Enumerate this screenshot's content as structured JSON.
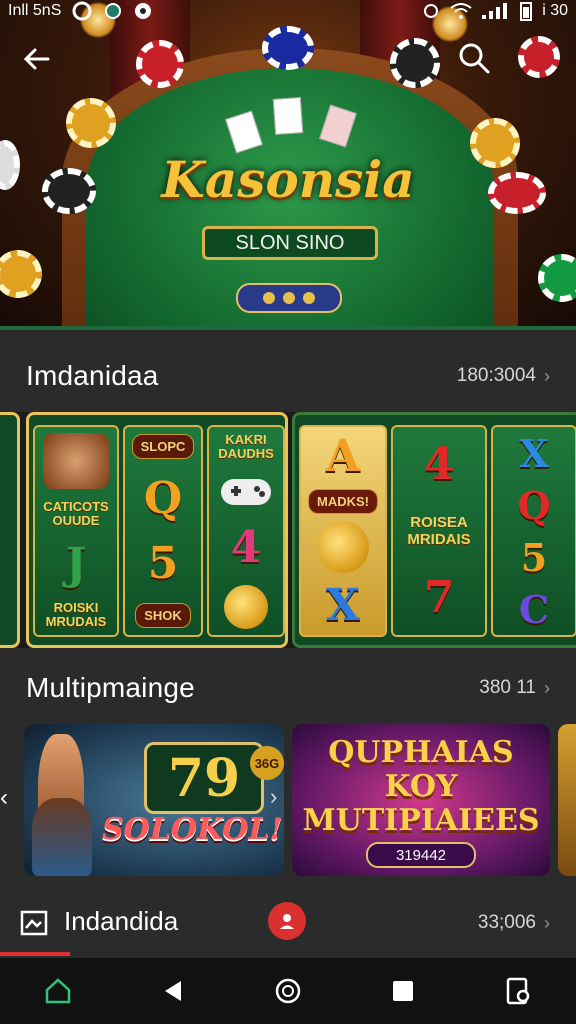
{
  "status_bar": {
    "left_text": "Inll 5nS",
    "right_text": "i 30"
  },
  "hero": {
    "logo_text": "Kasonsia",
    "subtitle": "SLON SINO"
  },
  "sections": [
    {
      "title": "Imdanidaa",
      "count": "180:3004"
    },
    {
      "title": "Multipmainge",
      "count": "380 11"
    },
    {
      "title": "Indandida",
      "count": "33;006"
    }
  ],
  "reels": {
    "panel1": {
      "col1_top": "CATICOTS\nOUUDE",
      "col1_bottom": "ROISKI\nMRUDAIS",
      "col2_top": "SLOPC",
      "col2_sym1": "Q",
      "col2_sym2": "5",
      "col2_bottom": "SHOK",
      "col3_top": "KAKRI\nDAUDHS",
      "col3_sym": "4"
    },
    "panel2": {
      "col1_sym1": "A",
      "col1_text": "MADKS!",
      "col1_sym2": "X",
      "col2_sym1": "4",
      "col2_text": "ROISEA\nMRIDAIS",
      "col2_sym2": "7",
      "col3_sym1": "X",
      "col3_sym2": "Q",
      "col3_sym3": "5",
      "col3_sym4": "C"
    }
  },
  "cards": {
    "card1": {
      "number": "79",
      "title": "SOLOKOL!",
      "badge": "36G"
    },
    "card2": {
      "title": "QUPHAIAS\nKOY\nMUTIPIAIEES",
      "sub": "319442"
    }
  },
  "colors": {
    "accent_red": "#e03030",
    "gold": "#e8c45a",
    "felt_green": "#146b30"
  },
  "icons": [
    "back-arrow-icon",
    "search-icon",
    "home-icon",
    "back-triangle-icon",
    "circle-home-icon",
    "square-recents-icon",
    "profile-icon"
  ]
}
